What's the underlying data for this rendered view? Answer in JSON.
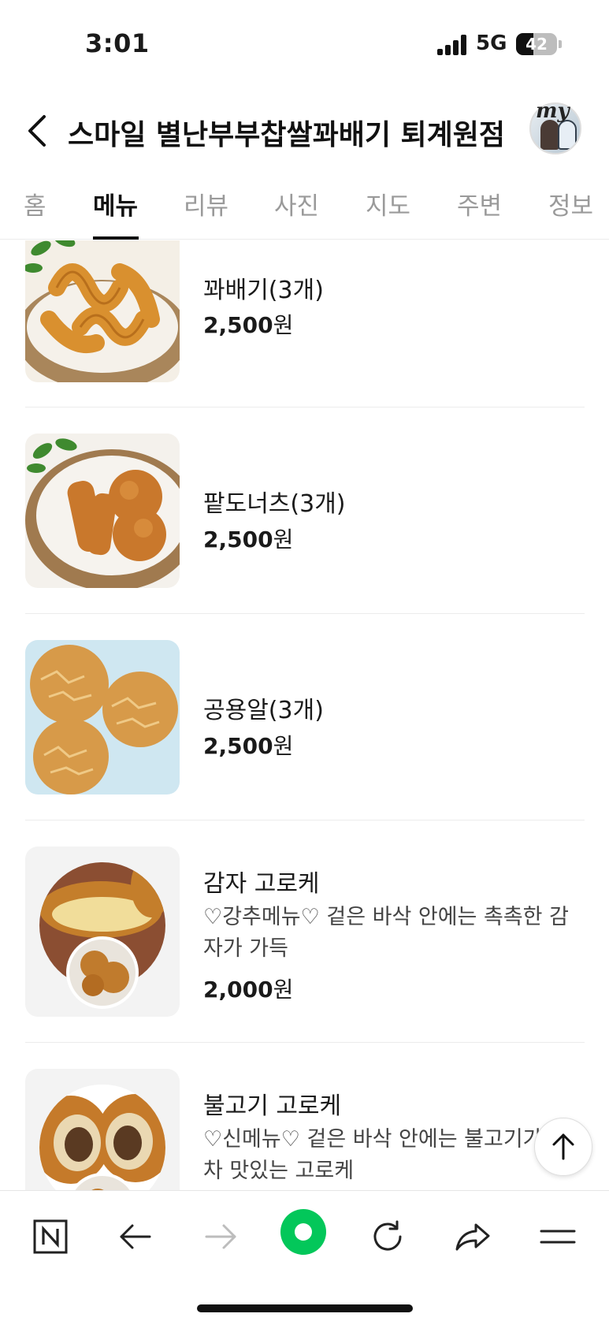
{
  "status_bar": {
    "time": "3:01",
    "network": "5G",
    "battery": "42",
    "battery_level": 0.42,
    "signal_bars": 4
  },
  "header": {
    "title": "스마일 별난부부찹쌀꽈배기 퇴계원점",
    "avatar_label": "my"
  },
  "tabs": [
    {
      "label": "홈",
      "active": false
    },
    {
      "label": "메뉴",
      "active": true
    },
    {
      "label": "리뷰",
      "active": false
    },
    {
      "label": "사진",
      "active": false
    },
    {
      "label": "지도",
      "active": false
    },
    {
      "label": "주변",
      "active": false
    },
    {
      "label": "정보",
      "active": false
    }
  ],
  "menu": {
    "items": [
      {
        "name": "꽈배기(3개)",
        "description": "",
        "price": "2,500",
        "currency": "원",
        "image_icon": "twisted-donut-photo"
      },
      {
        "name": "팥도너츠(3개)",
        "description": "",
        "price": "2,500",
        "currency": "원",
        "image_icon": "red-bean-donut-photo"
      },
      {
        "name": "공용알(3개)",
        "description": "",
        "price": "2,500",
        "currency": "원",
        "image_icon": "round-bread-photo"
      },
      {
        "name": "감자 고로케",
        "description": "♡강추메뉴♡ 겉은 바삭 안에는 촉촉한 감자가 가득",
        "price": "2,000",
        "currency": "원",
        "image_icon": "potato-croquette-photo"
      },
      {
        "name": "불고기 고로케",
        "description": "♡신메뉴♡ 겉은 바삭 안에는 불고기가 득차 맛있는 고로케",
        "price": "",
        "currency": "",
        "image_icon": "bulgogi-croquette-photo"
      }
    ]
  },
  "colors": {
    "accent_green": "#03c75a",
    "text_primary": "#1a1a1a",
    "text_muted": "#9a9a9a",
    "divider": "#ececec"
  }
}
